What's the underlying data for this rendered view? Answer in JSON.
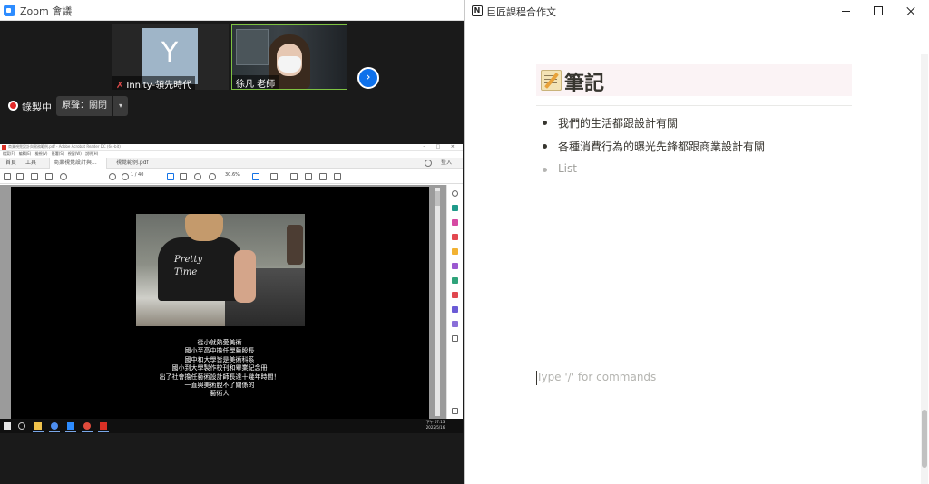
{
  "zoom": {
    "window_title": "Zoom 會議",
    "participants": [
      {
        "avatar_letter": "Y",
        "name": "Innity-領先時代",
        "muted": true
      },
      {
        "name": "徐凡 老師",
        "active_speaker": true
      }
    ],
    "recording_label": "錄製中",
    "original_sound_label": "原聲：關閉",
    "next_page_glyph": "›",
    "dropdown_glyph": "▾"
  },
  "acrobat": {
    "title_text": "商業視覺設計與實務範例.pdf - Adobe Acrobat Reader DC (64-bit)",
    "window_controls": "– □ ×",
    "menu_items": [
      "檔案(F)",
      "編輯(E)",
      "檢視(V)",
      "簽署(S)",
      "視窗(W)",
      "說明(H)"
    ],
    "tabs": [
      "首頁",
      "工具",
      "商業視覺設計與...",
      "視覺範例.pdf"
    ],
    "login_label": "登入",
    "page_indicator": "1 / 40",
    "zoom_level": "30.6%",
    "photo_script": [
      "Pretty",
      "Time"
    ],
    "page_text_lines": [
      "從小就熱愛美術",
      "國小至高中擔任學藝股長",
      "國中和大學皆是美術科系",
      "國小到大學製作校刊和畢業紀念冊",
      "出了社會擔任藝術設計師長達十幾年時間！",
      "一直與美術脫不了關係的",
      "藝術人"
    ],
    "clock": {
      "time": "下午 07:13",
      "date": "2022/5/16"
    }
  },
  "notion": {
    "window_title": "巨匠課程合作文",
    "logo_letter": "N",
    "heading": "筆記",
    "bullets": [
      "我們的生活都跟設計有關",
      "各種消費行為的曝光先鋒都跟商業設計有關"
    ],
    "list_placeholder": "List",
    "command_placeholder": "Type '/' for commands"
  },
  "colors": {
    "zoom_blue": "#2d8cff",
    "rec_red": "#e02828",
    "speaker_green": "#7ec242",
    "notion_text": "#37352f",
    "heading_bg": "#fbf3f5"
  },
  "icons": [
    "zoom-logo-icon",
    "mic-muted-icon",
    "chevron-right-icon",
    "record-icon",
    "chevron-down-icon",
    "notion-logo-icon",
    "memo-emoji-icon",
    "minimize-icon",
    "maximize-icon",
    "close-icon"
  ]
}
